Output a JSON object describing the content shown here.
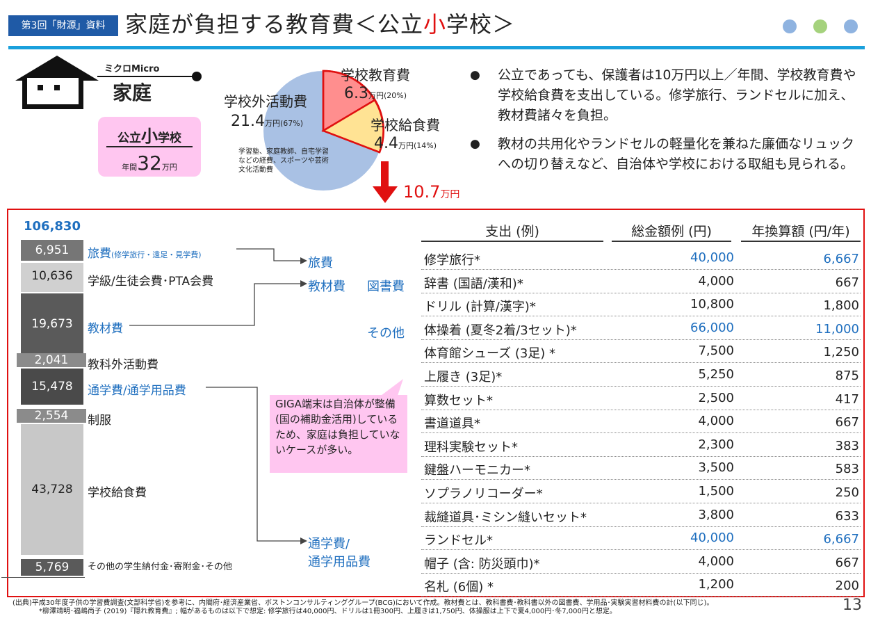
{
  "header": {
    "badge": "第3回「財源」資料",
    "title_pre": "家庭が負担する教育費＜公立",
    "title_red": "小",
    "title_post": "学校＞",
    "dot_colors": [
      "#8fb3e0",
      "#a5d27d",
      "#8fb3e0"
    ]
  },
  "house": {
    "micro_label": "ミクロMicro",
    "name": "家庭",
    "box_prefix": "公立",
    "box_big": "小",
    "box_suffix": "学校",
    "annual_prefix": "年間",
    "annual_amount": "32",
    "annual_unit": "万円"
  },
  "pie": {
    "outside_label": "学校外活動費",
    "outside_value": "21.4",
    "outside_unit": "万円(67%)",
    "outside_note": "学習塾、家庭教師、自宅学習などの経費、スポーツや芸術文化活動費",
    "school_label": "学校教育費",
    "school_value": "6.3",
    "school_unit": "万円(20%)",
    "lunch_label": "学校給食費",
    "lunch_value": "4.4",
    "lunch_unit": "万円(14%)",
    "sum_value": "10.7",
    "sum_unit": "万円"
  },
  "bullets": [
    "公立であっても、保護者は10万円以上／年間、学校教育費や学校給食費を支出している。修学旅行、ランドセルに加え、教材費諸々を負担。",
    "教材の共用化やランドセルの軽量化を兼ねた廉価なリュックへの切り替えなど、自治体や学校における取組も見られる。"
  ],
  "breakdown": {
    "total": "106,830",
    "items": [
      {
        "value": "6,951",
        "label": "旅費",
        "sub": "(修学旅行・遠足・見学費)"
      },
      {
        "value": "10,636",
        "label": "学級/生徒会費･PTA会費",
        "sub": ""
      },
      {
        "value": "19,673",
        "label": "教材費",
        "sub": ""
      },
      {
        "value": "2,041",
        "label": "教科外活動費",
        "sub": ""
      },
      {
        "value": "15,478",
        "label": "通学費/通学用品費",
        "sub": ""
      },
      {
        "value": "2,554",
        "label": "制服",
        "sub": ""
      },
      {
        "value": "43,728",
        "label": "学校給食費",
        "sub": ""
      },
      {
        "value": "5,769",
        "label": "その他の学生納付金･寄附金･その他",
        "sub": ""
      }
    ]
  },
  "mid_labels": {
    "travel": "旅費",
    "materials": "教材費",
    "books": "図書費",
    "other": "その他",
    "commute1": "通学費/",
    "commute2": "通学用品費"
  },
  "callout": "GIGA端末は自治体が整備(国の補助金活用)しているため、家庭は負担していないケースが多い。",
  "table": {
    "headers": [
      "支出 (例)",
      "総金額例 (円)",
      "年換算額 (円/年)"
    ],
    "rows": [
      {
        "item": "修学旅行*",
        "total": "40,000",
        "annual": "6,667",
        "blue": true
      },
      {
        "item": "辞書 (国語/漢和)*",
        "total": "4,000",
        "annual": "667",
        "blue": false
      },
      {
        "item": "ドリル (計算/漢字)*",
        "total": "10,800",
        "annual": "1,800",
        "blue": false
      },
      {
        "item": "体操着 (夏冬2着/3セット)*",
        "total": "66,000",
        "annual": "11,000",
        "blue": true
      },
      {
        "item": "体育館シューズ (3足) *",
        "total": "7,500",
        "annual": "1,250",
        "blue": false
      },
      {
        "item": "上履き (3足)*",
        "total": "5,250",
        "annual": "875",
        "blue": false
      },
      {
        "item": "算数セット*",
        "total": "2,500",
        "annual": "417",
        "blue": false
      },
      {
        "item": "書道道具*",
        "total": "4,000",
        "annual": "667",
        "blue": false
      },
      {
        "item": "理科実験セット*",
        "total": "2,300",
        "annual": "383",
        "blue": false
      },
      {
        "item": "鍵盤ハーモニカー*",
        "total": "3,500",
        "annual": "583",
        "blue": false
      },
      {
        "item": "ソプラノリコーダー*",
        "total": "1,500",
        "annual": "250",
        "blue": false
      },
      {
        "item": "裁縫道具･ミシン縫いセット*",
        "total": "3,800",
        "annual": "633",
        "blue": false
      },
      {
        "item": "ランドセル*",
        "total": "40,000",
        "annual": "6,667",
        "blue": true
      },
      {
        "item": "帽子 (含: 防災頭巾)*",
        "total": "4,000",
        "annual": "667",
        "blue": false
      },
      {
        "item": "名札 (6個) *",
        "total": "1,200",
        "annual": "200",
        "blue": false
      }
    ]
  },
  "footnote1": "(出典)平成30年度子供の学習費調査(文部科学省)を参考に、内閣府･経済産業省、ボストンコンサルティンググループ(BCG)において作成。教材費とは、教科書費･教科書以外の図書費、学用品･実験実習材料費の計(以下同じ)。",
  "footnote2": "*柳澤靖明･福嶋尚子 (2019)『隠れ教育費』; 幅があるものは以下で想定: 修学旅行は40,000円、ドリルは1冊300円、上履きは1,750円、体操服は上下で夏4,000円･冬7,000円と想定。",
  "page_number": "13"
}
